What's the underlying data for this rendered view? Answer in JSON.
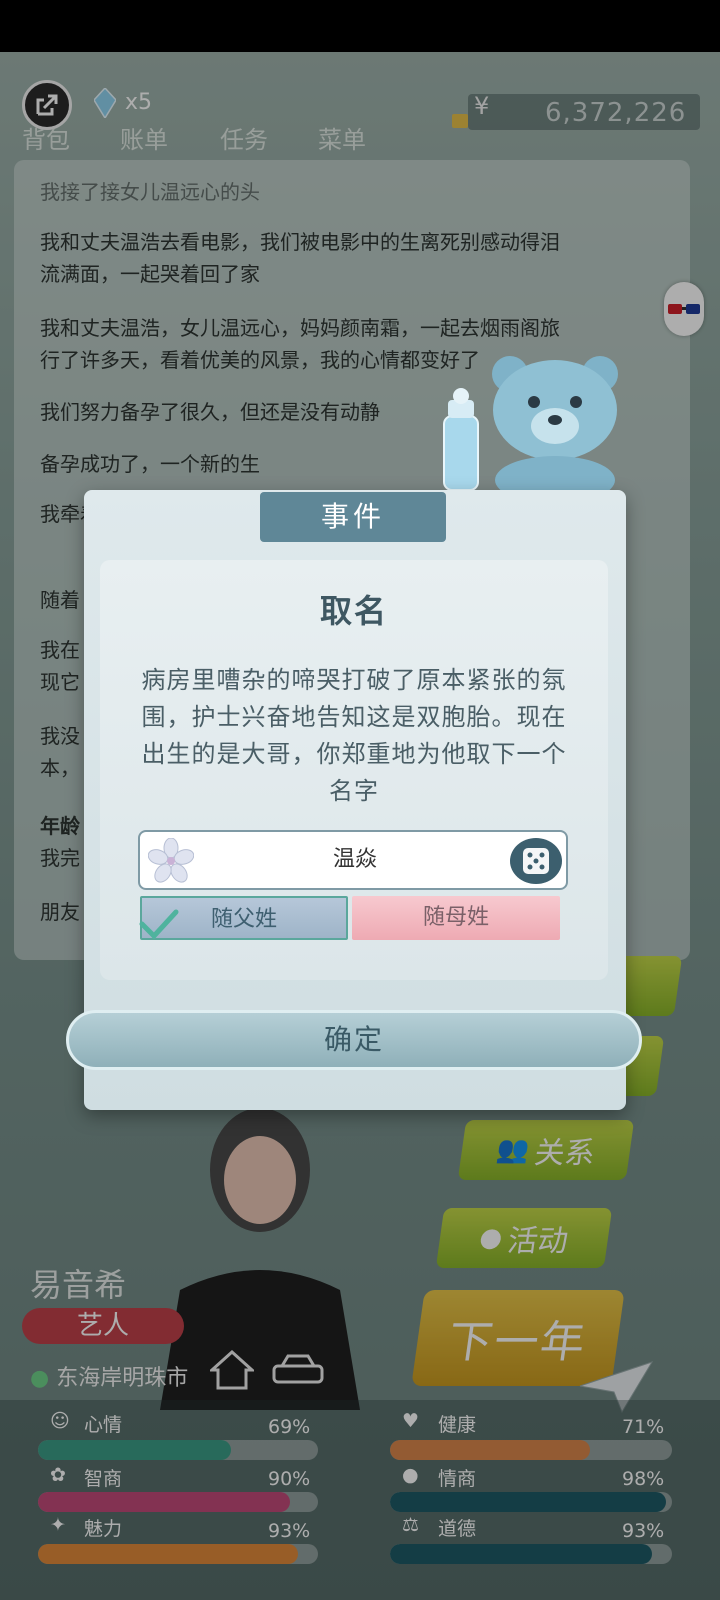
{
  "status_bar": {},
  "top_bar": {
    "tabs": [
      "背包",
      "账单",
      "任务",
      "菜单"
    ],
    "diamond_count": "x5",
    "currency_symbol": "¥",
    "money": "6,372,226"
  },
  "log": {
    "lines": [
      "我接了接女儿温远心的头",
      "我和丈夫温浩去看电影，我们被电影中的生离死别感动得泪",
      "流满面，一起哭着回了家",
      "我和丈夫温浩，女儿温远心，妈妈颜南霜，一起去烟雨阁旅",
      "行了许多天，看着优美的风景，我的心情都变好了",
      "我们努力备孕了很久，但还是没有动静",
      "备孕成功了，一个新的生",
      "我牵着",
      "随着",
      "我在",
      "现它",
      "我没",
      "本，",
      "年龄",
      "我完",
      "朋友"
    ]
  },
  "side_buttons": {
    "relation": "关系",
    "activity": "活动",
    "next_year": "下一年"
  },
  "character": {
    "name": "易音希",
    "job": "艺人",
    "location": "东海岸明珠市"
  },
  "stats": {
    "mood_label": "心情",
    "mood_pct": "69%",
    "mood": 0.69,
    "iq_label": "智商",
    "iq_pct": "90%",
    "iq": 0.9,
    "charm_label": "魅力",
    "charm_pct": "93%",
    "charm": 0.93,
    "health_label": "健康",
    "health_pct": "71%",
    "health": 0.71,
    "eq_label": "情商",
    "eq_pct": "98%",
    "eq": 0.98,
    "moral_label": "道德",
    "moral_pct": "93%",
    "moral": 0.93
  },
  "modal": {
    "header": "事件",
    "title": "取名",
    "description": "病房里嘈杂的啼哭打破了原本紧张的氛围，护士兴奋地告知这是双胞胎。现在出生的是大哥，你郑重地为他取下一个名字",
    "name_value": "温焱",
    "father_surname": "随父姓",
    "mother_surname": "随母姓",
    "confirm": "确定"
  },
  "colors": {
    "header_bg": "#5f8797",
    "confirm_bg": "#9fbfc7",
    "next_year": "#e3b83a",
    "green_btn": "#a9c83a"
  }
}
